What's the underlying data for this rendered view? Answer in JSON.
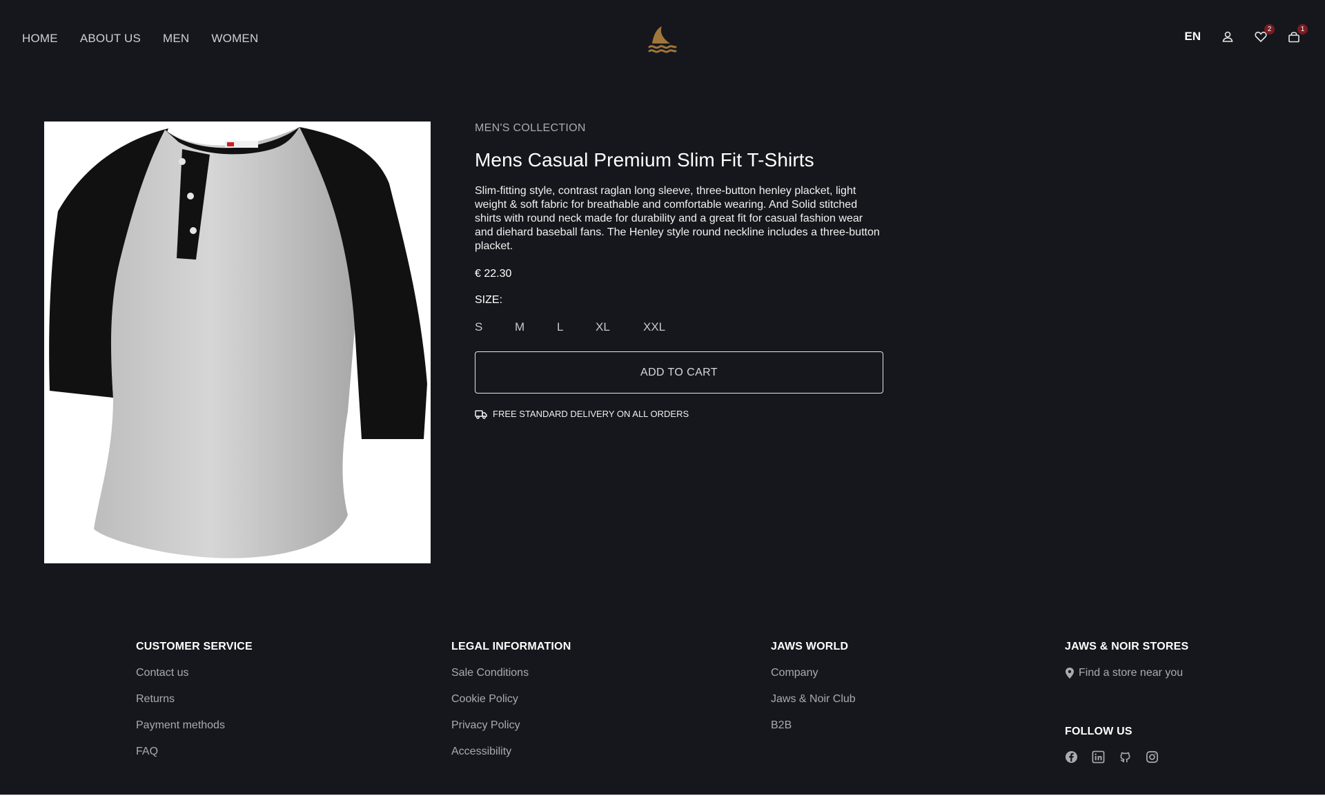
{
  "header": {
    "nav": [
      "HOME",
      "ABOUT US",
      "MEN",
      "WOMEN"
    ],
    "logo_icon": "shark-fin-logo-icon",
    "logo_color": "#a0773a",
    "language": "EN",
    "wishlist_count": "2",
    "cart_count": "1",
    "badge_color": "#7a1b22"
  },
  "product": {
    "collection": "MEN'S COLLECTION",
    "title": "Mens Casual Premium Slim Fit T-Shirts",
    "description": "Slim-fitting style, contrast raglan long sleeve, three-button henley placket, light weight & soft fabric for breathable and comfortable wearing. And Solid stitched shirts with round neck made for durability and a great fit for casual fashion wear and diehard baseball fans. The Henley style round neckline includes a three-button placket.",
    "price": "€ 22.30",
    "size_label": "SIZE:",
    "sizes": [
      "S",
      "M",
      "L",
      "XL",
      "XXL"
    ],
    "add_to_cart": "ADD TO CART",
    "delivery": "FREE STANDARD DELIVERY ON ALL ORDERS"
  },
  "footer": {
    "customer_service": {
      "title": "CUSTOMER SERVICE",
      "links": [
        "Contact us",
        "Returns",
        "Payment methods",
        "FAQ"
      ]
    },
    "legal": {
      "title": "LEGAL INFORMATION",
      "links": [
        "Sale Conditions",
        "Cookie Policy",
        "Privacy Policy",
        "Accessibility"
      ]
    },
    "jaws_world": {
      "title": "JAWS WORLD",
      "links": [
        "Company",
        "Jaws & Noir Club",
        "B2B"
      ]
    },
    "stores": {
      "title": "JAWS & NOIR STORES",
      "find_store": "Find a store near you",
      "follow_title": "FOLLOW US",
      "socials": [
        "facebook-icon",
        "linkedin-icon",
        "github-icon",
        "instagram-icon"
      ]
    }
  }
}
